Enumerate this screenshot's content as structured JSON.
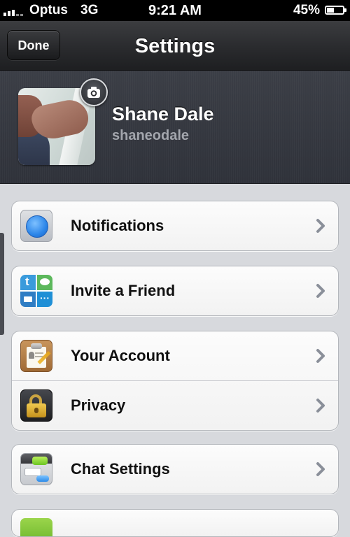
{
  "status_bar": {
    "carrier": "Optus",
    "network": "3G",
    "time": "9:21 AM",
    "battery_percent": "45%",
    "battery_level": 0.45
  },
  "nav_bar": {
    "done_label": "Done",
    "title": "Settings"
  },
  "profile": {
    "name": "Shane Dale",
    "username": "shaneodale"
  },
  "groups": [
    {
      "rows": [
        {
          "label": "Notifications",
          "icon": "notifications-icon"
        }
      ]
    },
    {
      "rows": [
        {
          "label": "Invite a Friend",
          "icon": "invite-friend-icon"
        }
      ]
    },
    {
      "rows": [
        {
          "label": "Your Account",
          "icon": "account-clipboard-icon"
        },
        {
          "label": "Privacy",
          "icon": "padlock-icon"
        }
      ]
    },
    {
      "rows": [
        {
          "label": "Chat Settings",
          "icon": "chat-settings-icon"
        }
      ]
    }
  ],
  "colors": {
    "nav_bar": "#2b2c2f",
    "profile_header": "#353841",
    "background": "#d7d9dd",
    "chevron": "#8a8f99"
  }
}
